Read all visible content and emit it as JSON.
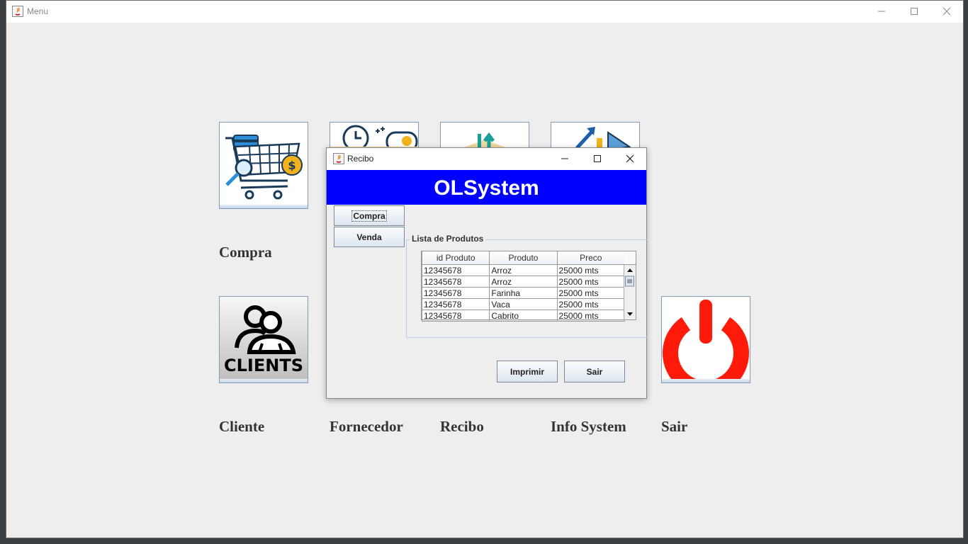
{
  "main_window": {
    "title": "Menu",
    "tiles": [
      {
        "label": "Compra",
        "icon": "shopping-cart-icon"
      },
      {
        "label": "Fornecedor",
        "icon": "supplier-delivery-icon"
      },
      {
        "label": "Recibo",
        "icon": "receipt-growth-icon"
      },
      {
        "label": "Info System",
        "icon": "chart-arrow-icon"
      },
      {
        "label": "Cliente",
        "icon": "clients-icon",
        "icon_text": "CLIENTS"
      },
      {
        "label": "Sair",
        "icon": "power-icon"
      }
    ]
  },
  "dialog": {
    "title": "Recibo",
    "banner": "OLSystem",
    "nav_buttons": {
      "compra": "Compra",
      "venda": "Venda"
    },
    "group_title": "Lista de Produtos",
    "table": {
      "columns": [
        "id Produto",
        "Produto",
        "Preco"
      ],
      "rows": [
        [
          "12345678",
          "Arroz",
          "25000 mts"
        ],
        [
          "12345678",
          "Arroz",
          "25000 mts"
        ],
        [
          "12345678",
          "Farinha",
          "25000 mts"
        ],
        [
          "12345678",
          "Vaca",
          "25000 mts"
        ],
        [
          "12345678",
          "Cabrito",
          "25000 mts"
        ]
      ]
    },
    "buttons": {
      "print": "Imprimir",
      "exit": "Sair"
    }
  },
  "colors": {
    "banner_bg": "#0000ff",
    "power_red": "#ff1a0a"
  }
}
